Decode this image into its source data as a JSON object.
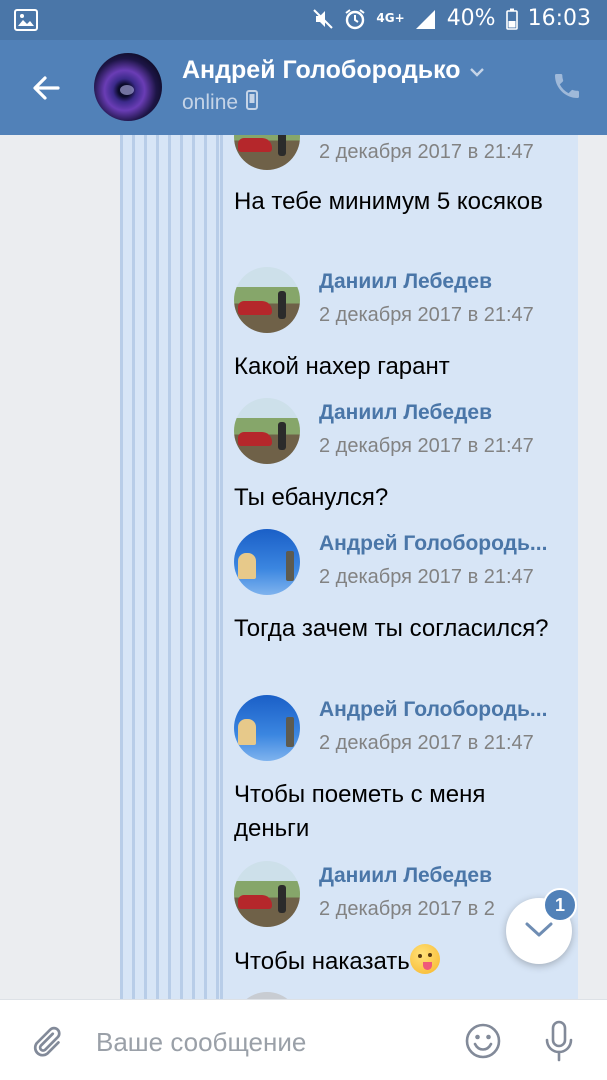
{
  "status_bar": {
    "network": "4G+",
    "battery": "40%",
    "time": "16:03"
  },
  "header": {
    "name": "Андрей Голобородько",
    "status": "online"
  },
  "messages": [
    {
      "time": "2 декабря 2017 в 21:47"
    },
    {
      "text": "На тебе минимум 5 косяков"
    },
    {
      "name": "Даниил Лебедев",
      "time": "2 декабря 2017 в 21:47"
    },
    {
      "text": "Какой нахер гарант"
    },
    {
      "name": "Даниил Лебедев",
      "time": "2 декабря 2017 в 21:47"
    },
    {
      "text": "Ты ебанулся?"
    },
    {
      "name": "Андрей Голобородь...",
      "time": "2 декабря 2017 в 21:47"
    },
    {
      "text": "Тогда зачем ты согласился?"
    },
    {
      "name": "Андрей Голобородь...",
      "time": "2 декабря 2017 в 21:47"
    },
    {
      "text": "Чтобы поеметь с меня деньги"
    },
    {
      "name": "Даниил Лебедев",
      "time": "2 декабря 2017 в 2"
    },
    {
      "text": "Чтобы наказать"
    }
  ],
  "scroll_down": {
    "badge": "1"
  },
  "input": {
    "placeholder": "Ваше сообщение"
  },
  "colors": {
    "header": "#5181b8",
    "status_bar": "#4a76a8",
    "forward_bg": "#d7e5f6",
    "name_link": "#4a76a8"
  },
  "icons": [
    "gallery-icon",
    "mute-icon",
    "alarm-icon",
    "signal-icon",
    "battery-icon",
    "back-arrow-icon",
    "chevron-down-icon",
    "mobile-icon",
    "phone-icon",
    "chevron-down-icon",
    "paperclip-icon",
    "smile-icon",
    "microphone-icon"
  ]
}
